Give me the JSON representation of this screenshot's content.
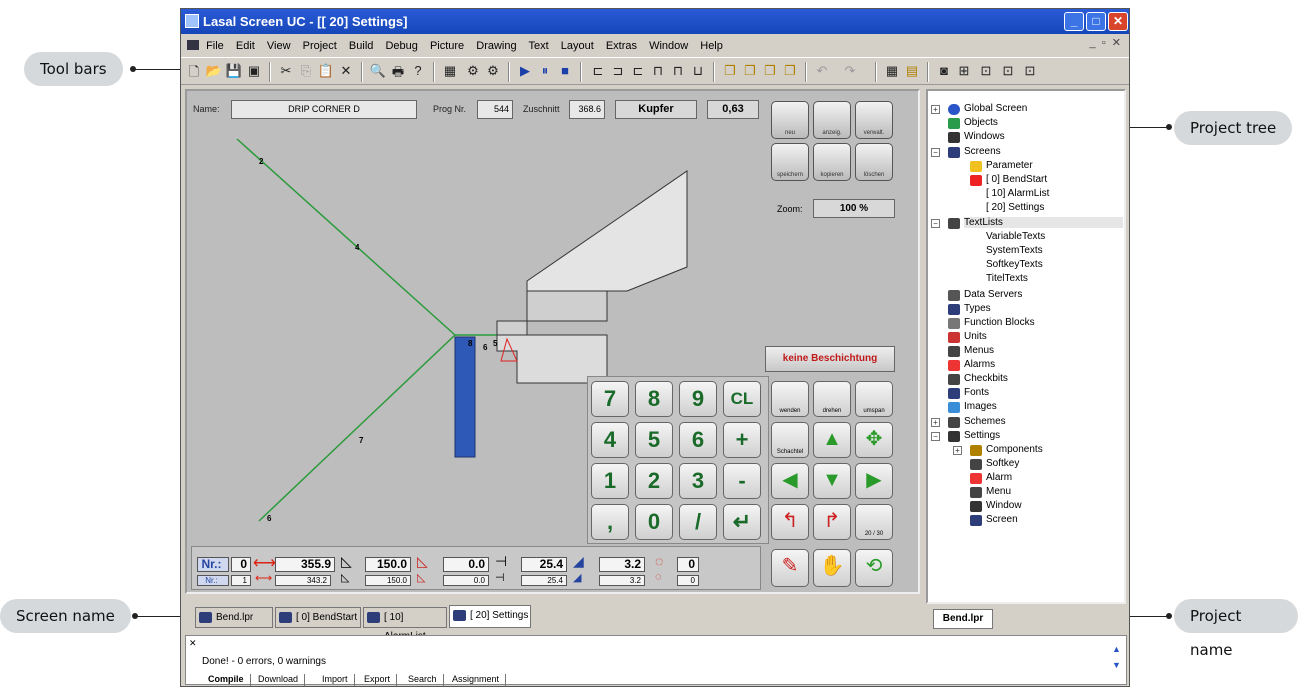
{
  "window": {
    "title": "Lasal Screen UC - [[ 20] Settings]"
  },
  "menu": [
    "File",
    "Edit",
    "View",
    "Project",
    "Build",
    "Debug",
    "Picture",
    "Drawing",
    "Text",
    "Layout",
    "Extras",
    "Window",
    "Help"
  ],
  "callouts": {
    "toolbars": "Tool bars",
    "screen_name": "Screen name",
    "project_tree": "Project tree",
    "project_name": "Project name"
  },
  "screen": {
    "name_label": "Name:",
    "name_value": "DRIP CORNER D",
    "prog_label": "Prog Nr.",
    "prog_value": "544",
    "zuschnitt_label": "Zuschnitt",
    "zuschnitt_value": "368.6",
    "material": "Kupfer",
    "thickness": "0,63",
    "zoom_label": "Zoom:",
    "zoom_value": "100 %",
    "coating": "keine Beschichtung",
    "side_buttons": [
      "neu",
      "anzeig.",
      "verwalt.",
      "speichern",
      "kopieren",
      "löschen"
    ],
    "right_buttons": [
      "wenden",
      "drehen",
      "umspan",
      "Schachtel",
      "20 / 30"
    ],
    "keypad": [
      "7",
      "8",
      "9",
      "CL",
      "4",
      "5",
      "6",
      "+",
      "1",
      "2",
      "3",
      "-",
      ",",
      "0",
      "/",
      "↵"
    ],
    "segments": [
      "2",
      "4",
      "7",
      "6",
      "8",
      "6",
      "5"
    ],
    "row1": {
      "nr_label": "Nr.:",
      "nr": "0",
      "length": "355.9",
      "angle": "150.0",
      "v3": "0.0",
      "v4": "25.4",
      "v5": "3.2",
      "v6": "0"
    },
    "row2": {
      "nr_label": "Nr.:",
      "nr": "1",
      "length": "343.2",
      "angle": "150.0",
      "v3": "0.0",
      "v4": "25.4",
      "v5": "3.2",
      "v6": "0"
    }
  },
  "editor_tabs": [
    "Bend.lpr",
    "[ 0] BendStart",
    "[ 10] AlarmList",
    "[ 20] Settings"
  ],
  "tree": {
    "items": [
      "Global Screen",
      "Objects",
      "Windows",
      "Screens",
      "Parameter",
      "[  0] BendStart",
      "[  10] AlarmList",
      "[  20] Settings",
      "TextLists",
      "VariableTexts",
      "SystemTexts",
      "SoftkeyTexts",
      "TitelTexts",
      "Data Servers",
      "Types",
      "Function Blocks",
      "Units",
      "Menus",
      "Alarms",
      "Checkbits",
      "Fonts",
      "Images",
      "Schemes",
      "Settings",
      "Components",
      "Softkey",
      "Alarm",
      "Menu",
      "Window",
      "Screen"
    ],
    "tab": "Bend.lpr"
  },
  "output": {
    "message": "Done! - 0 errors, 0 warnings",
    "tabs": [
      "Compile",
      "Download",
      "Import",
      "Export",
      "Search",
      "Assignment"
    ]
  }
}
